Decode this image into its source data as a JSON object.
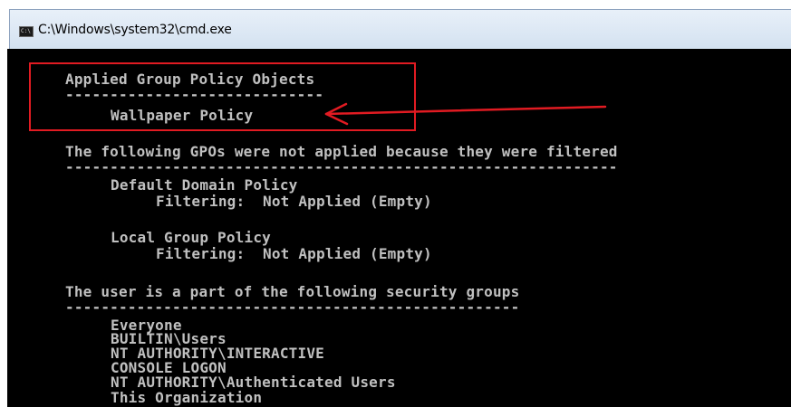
{
  "window": {
    "title": "C:\\Windows\\system32\\cmd.exe",
    "icon": "cmd-icon",
    "icon_glyph": "C:\\"
  },
  "console": {
    "lines": [
      "Applied Group Policy Objects",
      "-----------------------------",
      "Wallpaper Policy",
      "The following GPOs were not applied because they were filtered",
      "--------------------------------------------------------------",
      "Default Domain Policy",
      "Filtering:  Not Applied (Empty)",
      "Local Group Policy",
      "Filtering:  Not Applied (Empty)",
      "The user is a part of the following security groups",
      "---------------------------------------------------",
      "Everyone",
      "BUILTIN\\Users",
      "NT AUTHORITY\\INTERACTIVE",
      "CONSOLE LOGON",
      "NT AUTHORITY\\Authenticated Users",
      "This Organization"
    ]
  },
  "annotation": {
    "color": "#e11b22"
  }
}
